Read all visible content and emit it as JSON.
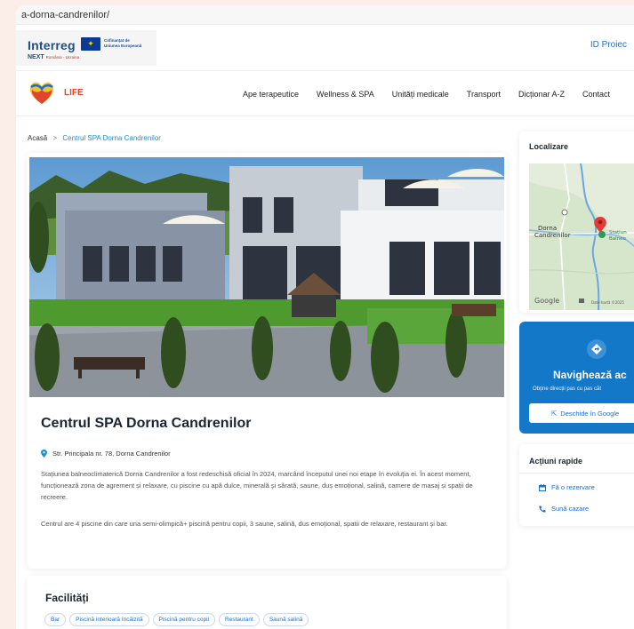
{
  "browser": {
    "url": "a-dorna-candrenilor/"
  },
  "header": {
    "logo_interreg": "Interreg",
    "eu_text_line1": "Cofinanțat de",
    "eu_text_line2": "Uniunea Europeană",
    "logo_next": "NEXT",
    "logo_next_sub": "România - Ucraina",
    "id_link": "ID Proiec"
  },
  "nav": {
    "brand": "LIFE",
    "items": [
      {
        "label": "Ape terapeutice"
      },
      {
        "label": "Wellness & SPA"
      },
      {
        "label": "Unități medicale"
      },
      {
        "label": "Transport"
      },
      {
        "label": "Dicționar A-Z"
      },
      {
        "label": "Contact"
      }
    ]
  },
  "breadcrumb": {
    "home": "Acasă",
    "separator": ">",
    "current": "Centrul SPA Dorna Candrenilor"
  },
  "main": {
    "title": "Centrul SPA Dorna Candrenilor",
    "address": "Str. Principala nr. 78, Dorna Candrenilor",
    "paragraph1": "Stațiunea balneoclimaterică Dorna Candrenilor a fost redeschisă oficial în 2024, marcând începutul unei noi etape în evoluția ei. În acest moment, funcționează zona de agrement și relaxare, cu piscine cu apă dulce, minerală și sărată, saune, duș emoțional, salină, camere de masaj și spații de recreere.",
    "paragraph2": "Centrul are 4 piscine din care una semi-olimpică+ piscină pentru copii, 3 saune, salină, dus emoțional, spatii de relaxare, restaurant și bar."
  },
  "facilities": {
    "title": "Facilități",
    "tags": [
      "Bar",
      "Piscină interioară încălzită",
      "Piscină pentru copii",
      "Restaurant",
      "Saună salină"
    ]
  },
  "sidebar": {
    "location_title": "Localizare",
    "map_label_town": "Dorna\nCandrenilor",
    "map_label_poi": "Stațiun\nBalneo",
    "map_google": "Google",
    "map_data": "Date hartă ©2025",
    "navigate_title": "Navighează ac",
    "navigate_sub": "Obține direcții pas cu pas căt",
    "navigate_button": "Deschide în Google",
    "quick_title": "Acțiuni rapide",
    "quick_reserve": "Fă o rezervare",
    "quick_call": "Sună cazare"
  },
  "colors": {
    "accent": "#1f6fd1",
    "nav_card": "#1478c8",
    "brand_red": "#e0462b"
  }
}
